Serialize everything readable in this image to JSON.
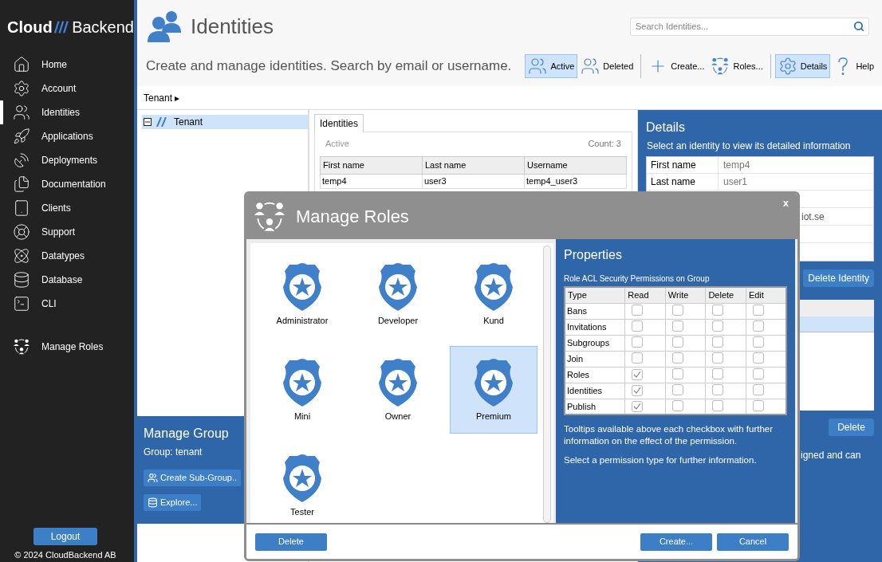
{
  "sidebar": {
    "logo": {
      "left": "Cloud",
      "right": "Backend"
    },
    "items": [
      {
        "label": "Home",
        "selected": false
      },
      {
        "label": "Account",
        "selected": false
      },
      {
        "label": "Identities",
        "selected": true
      },
      {
        "label": "Applications",
        "selected": false
      },
      {
        "label": "Deployments",
        "selected": false
      },
      {
        "label": "Documentation",
        "selected": false
      },
      {
        "label": "Clients",
        "selected": false
      },
      {
        "label": "Support",
        "selected": false
      },
      {
        "label": "Datatypes",
        "selected": false
      },
      {
        "label": "Database",
        "selected": false
      },
      {
        "label": "CLI",
        "selected": false
      }
    ],
    "manage_roles": "Manage Roles",
    "logout": "Logout",
    "footer": "© 2024 CloudBackend AB"
  },
  "header": {
    "title": "Identities",
    "search": {
      "placeholder": "Search Identities..."
    },
    "subtitle": "Create and manage identities. Search by email or username.",
    "toolbar": [
      {
        "label": "Active",
        "selected": true
      },
      {
        "label": "Deleted",
        "selected": false
      },
      {
        "label": "Create...",
        "selected": false
      },
      {
        "label": "Roles...",
        "selected": false
      },
      {
        "label": "Details",
        "selected": true
      },
      {
        "label": "Help",
        "selected": false
      }
    ]
  },
  "breadcrumb": "Tenant ▸",
  "tree": {
    "items": [
      {
        "label": "Tenant",
        "selected": true,
        "expanded": true
      }
    ]
  },
  "manage_group": {
    "title": "Manage Group",
    "group": "Group: tenant",
    "buttons": [
      "Create Sub-Group..",
      "Explore..."
    ]
  },
  "identities": {
    "tabs": [
      {
        "label": "Identities",
        "selected": true
      }
    ],
    "filter": "Active",
    "count": "Count: 3",
    "columns": [
      "First name",
      "Last name",
      "Username"
    ],
    "rows": [
      [
        "temp4",
        "user3",
        "temp4_user3"
      ]
    ]
  },
  "details": {
    "title": "Details",
    "hint": "Select an identity to view its detailed information",
    "fields": [
      {
        "label": "First name",
        "value": "temp4"
      },
      {
        "label": "Last name",
        "value": "user1"
      }
    ],
    "email_fragment": "iot.se",
    "delete_identity": "Delete Identity",
    "delete": "Delete",
    "note_fragment": "igned and can"
  },
  "dialog": {
    "title": "Manage Roles",
    "close": "x",
    "roles": [
      {
        "name": "Administrator",
        "selected": false
      },
      {
        "name": "Developer",
        "selected": false
      },
      {
        "name": "Kund",
        "selected": false
      },
      {
        "name": "Mini",
        "selected": false
      },
      {
        "name": "Owner",
        "selected": false
      },
      {
        "name": "Premium",
        "selected": true
      },
      {
        "name": "Tester",
        "selected": false
      }
    ],
    "properties": {
      "title": "Properties",
      "caption": "Role ACL Security Permissions on Group",
      "columns": [
        "Type",
        "Read",
        "Write",
        "Delete",
        "Edit"
      ],
      "rows": [
        {
          "type": "Bans",
          "checks": [
            false,
            false,
            false,
            false
          ]
        },
        {
          "type": "Invitations",
          "checks": [
            false,
            false,
            false,
            false
          ]
        },
        {
          "type": "Subgroups",
          "checks": [
            false,
            false,
            false,
            false
          ]
        },
        {
          "type": "Join",
          "checks": [
            false,
            false,
            false,
            false
          ]
        },
        {
          "type": "Roles",
          "checks": [
            true,
            false,
            false,
            false
          ]
        },
        {
          "type": "Identities",
          "checks": [
            true,
            false,
            false,
            false
          ]
        },
        {
          "type": "Publish",
          "checks": [
            true,
            false,
            false,
            false
          ]
        }
      ],
      "notes": [
        "Tooltips available above each checkbox with further information on the effect of the permission.",
        "Select a permission type for further information."
      ]
    },
    "buttons": {
      "delete": "Delete",
      "create": "Create...",
      "cancel": "Cancel"
    }
  }
}
